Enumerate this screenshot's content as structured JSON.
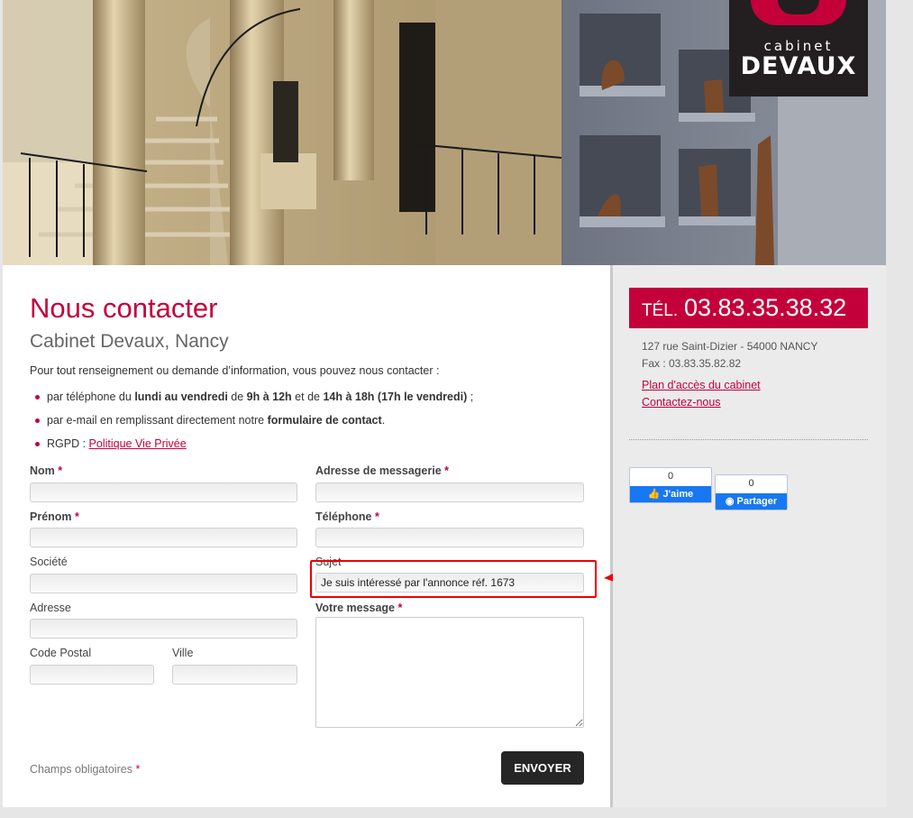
{
  "logo": {
    "line1": "cabinet",
    "line2": "DEVAUX"
  },
  "page": {
    "title": "Nous contacter",
    "subtitle": "Cabinet Devaux, Nancy",
    "intro": "Pour tout renseignement ou demande d’information, vous pouvez nous contacter :"
  },
  "ways": {
    "phone": {
      "p1": "par téléphone du ",
      "b1": "lundi au vendredi",
      "p2": " de ",
      "b2": "9h à 12h",
      "p3": " et de ",
      "b3": "14h à 18h (17h le vendredi)",
      "p4": " ;"
    },
    "email": {
      "p1": "par e-mail en remplissant directement notre ",
      "b1": "formulaire de contact",
      "p2": "."
    },
    "rgpd": {
      "p1": "RGPD : ",
      "link": "Politique Vie Privée"
    }
  },
  "form": {
    "nom": {
      "label": "Nom",
      "value": ""
    },
    "email": {
      "label": "Adresse de messagerie",
      "value": ""
    },
    "prenom": {
      "label": "Prénom",
      "value": ""
    },
    "telephone": {
      "label": "Téléphone",
      "value": ""
    },
    "societe": {
      "label": "Société",
      "value": ""
    },
    "sujet": {
      "label": "Sujet",
      "value": "Je suis intéressé par l'annonce réf. 1673"
    },
    "adresse": {
      "label": "Adresse",
      "value": ""
    },
    "message": {
      "label": "Votre message",
      "value": ""
    },
    "cp": {
      "label": "Code Postal",
      "value": ""
    },
    "ville": {
      "label": "Ville",
      "value": ""
    },
    "required_star": "*",
    "mandatory_note": "Champs obligatoires",
    "submit": "ENVOYER"
  },
  "sidebar": {
    "tel_prefix": "TÉL.",
    "tel_number": "03.83.35.38.32",
    "address": "127 rue Saint-Dizier - 54000 NANCY",
    "fax": "Fax : 03.83.35.82.82",
    "map_link": "Plan d'accès du cabinet",
    "contact_link": "Contactez-nous"
  },
  "social": {
    "like_count": "0",
    "like_label": "J'aime",
    "share_count": "0",
    "share_label": "Partager"
  },
  "colors": {
    "accent": "#c4003b",
    "annotation": "#e00000"
  }
}
